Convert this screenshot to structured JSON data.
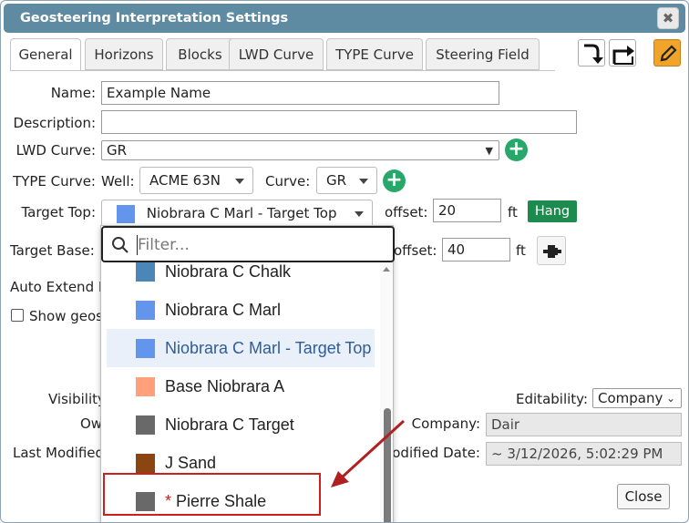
{
  "window": {
    "title": "Geosteering Interpretation Settings",
    "close_glyph": "✖"
  },
  "tabs": [
    {
      "label": "General",
      "active": true
    },
    {
      "label": "Horizons"
    },
    {
      "label": "Blocks"
    },
    {
      "label": "LWD Curve"
    },
    {
      "label": "TYPE Curve"
    },
    {
      "label": "Steering Field"
    }
  ],
  "toolbar": {
    "import_icon": "import-arrow-icon",
    "export_icon": "share-arrow-icon",
    "edit_icon": "pencil-icon"
  },
  "form": {
    "name_label": "Name:",
    "name_value": "Example Name",
    "description_label": "Description:",
    "description_value": "",
    "lwd_label": "LWD Curve:",
    "lwd_value": "GR",
    "type_label": "TYPE Curve:",
    "well_label": "Well:",
    "well_value": "ACME 63N",
    "curve_label": "Curve:",
    "curve_value": "GR",
    "target_top_label": "Target Top:",
    "target_top_value": "Niobrara C Marl - Target Top",
    "target_top_offset_label": "offset:",
    "target_top_offset": "20",
    "target_top_unit": "ft",
    "hang_label": "Hang",
    "target_base_label": "Target Base:",
    "target_base_offset_label": "offset:",
    "target_base_offset": "40",
    "target_base_unit": "ft",
    "auto_extend_label": "Auto Extend H",
    "show_geo_label": "Show geos",
    "visibility_label": "Visibility",
    "owner_label": "Ow",
    "last_modified_label": "Last Modified",
    "editability_label": "Editability:",
    "editability_value": "Company",
    "company_label": "Company:",
    "company_value": "Dair",
    "modified_date_label": "odified Date:",
    "modified_date_value": "~ 3/12/2026, 5:02:29 PM",
    "close_label": "Close"
  },
  "dropdown": {
    "filter_placeholder": "Filter...",
    "items": [
      {
        "label": "Niobrara C Chalk",
        "color": "#4a86b8"
      },
      {
        "label": "Niobrara C Marl",
        "color": "#6495ed"
      },
      {
        "label": "Niobrara C Marl - Target Top",
        "color": "#6495ed",
        "highlighted": true
      },
      {
        "label": "Base Niobrara A",
        "color": "#ffa07a"
      },
      {
        "label": "Niobrara C Target",
        "color": "#696969"
      },
      {
        "label": "J Sand",
        "color": "#8b4513"
      },
      {
        "label": "Pierre Shale",
        "color": "#696969",
        "marker": "*"
      }
    ]
  },
  "colors": {
    "titlebar": "#5e8aa2",
    "accent_green": "#27a86a",
    "hang_green": "#1e8b4e",
    "edit_orange": "#f0a429",
    "annotation_red": "#cc1f1f"
  }
}
